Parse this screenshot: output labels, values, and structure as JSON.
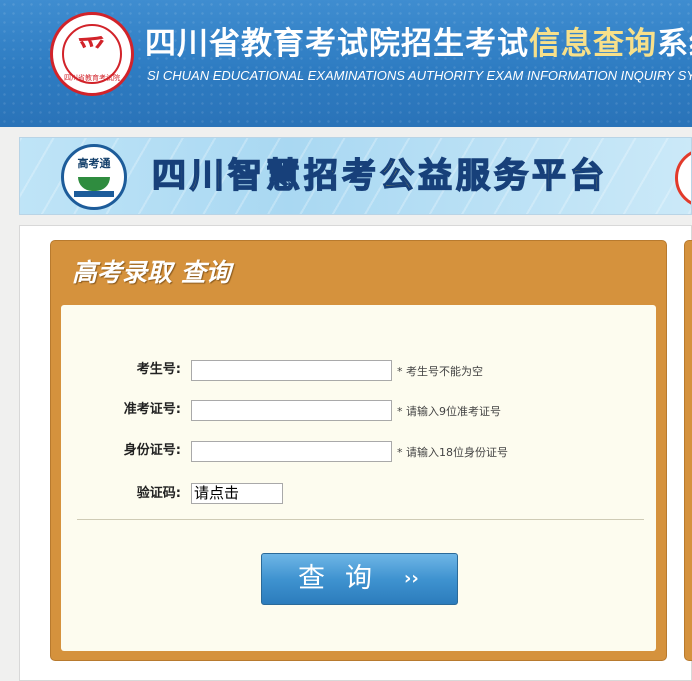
{
  "header": {
    "title_part1": "四川省教育考试院招生考试",
    "title_highlight": "信息查询",
    "title_part2": "系统",
    "subtitle_en": "SI CHUAN EDUCATIONAL EXAMINATIONS AUTHORITY EXAM INFORMATION INQUIRY SYSTEM",
    "logo_glyph": "爫",
    "logo_text": "四川省教育考试院"
  },
  "banner": {
    "title": "四川智慧招考公益服务平台",
    "logo_text": "高考通"
  },
  "panel": {
    "title": "高考录取  查询",
    "fields": [
      {
        "label": "考生号:",
        "value": "",
        "hint": "* 考生号不能为空"
      },
      {
        "label": "准考证号:",
        "value": "",
        "hint": "* 请输入9位准考证号"
      },
      {
        "label": "身份证号:",
        "value": "",
        "hint": "* 请输入18位身份证号"
      }
    ],
    "captcha_label": "验证码:",
    "captcha_text": "请点击",
    "submit_label": "查询",
    "submit_arrow": "››"
  },
  "colors": {
    "header_blue": "#2e7cc2",
    "panel_orange": "#d5923d",
    "button_blue": "#3f93d0",
    "title_highlight": "#f7e08a"
  }
}
